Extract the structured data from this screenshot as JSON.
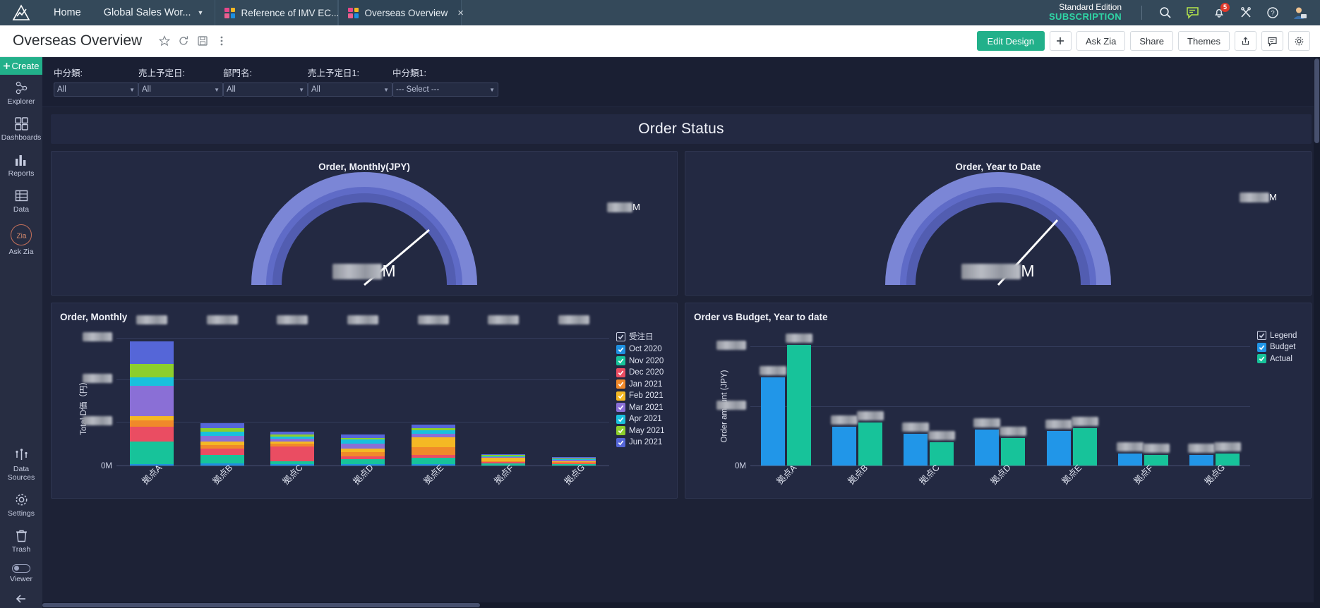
{
  "topbar": {
    "logo_name": "analytics-logo",
    "home_label": "Home",
    "workspace_label": "Global Sales Wor...",
    "tabs": [
      {
        "label": "Reference of IMV EC...",
        "active": false
      },
      {
        "label": "Overseas Overview",
        "active": true
      }
    ],
    "edition_line1": "Standard Edition",
    "edition_line2": "SUBSCRIPTION",
    "notification_count": "5",
    "icons": [
      "search-icon",
      "chat-icon",
      "notification-bell-icon",
      "tools-icon",
      "help-icon",
      "user-avatar-icon"
    ]
  },
  "actionbar": {
    "title": "Overseas Overview",
    "icons": [
      "star-icon",
      "refresh-icon",
      "save-icon",
      "more-options-icon"
    ],
    "edit_design_label": "Edit Design",
    "add_label": "+",
    "ask_zia_label": "Ask Zia",
    "share_label": "Share",
    "themes_label": "Themes",
    "right_icons": [
      "export-icon",
      "comment-icon",
      "settings-gear-icon"
    ]
  },
  "sidebar": {
    "create_label": "Create",
    "items": [
      {
        "label": "Explorer",
        "icon": "explorer-icon"
      },
      {
        "label": "Dashboards",
        "icon": "dashboards-icon"
      },
      {
        "label": "Reports",
        "icon": "reports-icon"
      },
      {
        "label": "Data",
        "icon": "data-icon"
      },
      {
        "label": "Ask Zia",
        "icon": "ask-zia-icon"
      }
    ],
    "bottom_items": [
      {
        "label": "Data Sources",
        "icon": "data-sources-icon"
      },
      {
        "label": "Settings",
        "icon": "settings-icon"
      },
      {
        "label": "Trash",
        "icon": "trash-icon"
      },
      {
        "label": "Viewer",
        "icon": "viewer-toggle-icon"
      }
    ]
  },
  "filters": [
    {
      "label": "中分類:",
      "value": "All"
    },
    {
      "label": "売上予定日:",
      "value": "All"
    },
    {
      "label": "部門名:",
      "value": "All"
    },
    {
      "label": "売上予定日1:",
      "value": "All"
    },
    {
      "label": "中分類1:",
      "value": "--- Select ---"
    }
  ],
  "banner_title": "Order Status",
  "gauges": [
    {
      "title": "Order, Monthly(JPY)",
      "center_value_redacted": true,
      "center_unit": "M",
      "tip_unit": "M",
      "needle_angle_deg": 52
    },
    {
      "title": "Order, Year to Date",
      "center_value_redacted": true,
      "center_unit": "M",
      "tip_unit": "M",
      "needle_angle_deg": 40
    }
  ],
  "chart_data": [
    {
      "type": "bar",
      "title": "Order, Monthly",
      "stacked": true,
      "ylabel": "Total D価（円）",
      "xlabel": "",
      "grid": true,
      "legend_position": "right",
      "legend_header": "受注日",
      "categories": [
        "拠点A",
        "拠点B",
        "拠点C",
        "拠点D",
        "拠点E",
        "拠点F",
        "拠点G"
      ],
      "ytick_labels": [
        "",
        "",
        "",
        "0M"
      ],
      "ytick_redacted": [
        true,
        true,
        true,
        false
      ],
      "series": [
        {
          "name": "Oct 2020",
          "color": "#1e8fe0",
          "values": [
            2,
            3,
            2,
            2,
            2,
            1,
            1
          ]
        },
        {
          "name": "Nov 2020",
          "color": "#17c39a",
          "values": [
            22,
            8,
            3,
            5,
            6,
            2,
            1
          ]
        },
        {
          "name": "Dec 2020",
          "color": "#ea4d62",
          "values": [
            15,
            6,
            14,
            3,
            3,
            1,
            1
          ]
        },
        {
          "name": "Jan 2021",
          "color": "#f0892a",
          "values": [
            6,
            4,
            3,
            4,
            8,
            1,
            1
          ]
        },
        {
          "name": "Feb 2021",
          "color": "#f4b824",
          "values": [
            4,
            3,
            2,
            3,
            9,
            3,
            1
          ]
        },
        {
          "name": "Mar 2021",
          "color": "#8a6fd6",
          "values": [
            30,
            6,
            3,
            5,
            4,
            1,
            1
          ]
        },
        {
          "name": "Apr 2021",
          "color": "#19c0dd",
          "values": [
            8,
            4,
            2,
            4,
            3,
            1,
            1
          ]
        },
        {
          "name": "May 2021",
          "color": "#8dce2c",
          "values": [
            13,
            3,
            2,
            2,
            2,
            1,
            1
          ]
        },
        {
          "name": "Jun 2021",
          "color": "#5566d8",
          "values": [
            22,
            5,
            3,
            3,
            4,
            1,
            1
          ]
        }
      ]
    },
    {
      "type": "bar",
      "title": "Order vs Budget, Year to date",
      "stacked": false,
      "ylabel": "Order amount (JPY)",
      "xlabel": "",
      "grid": true,
      "legend_position": "right",
      "legend_header": "Legend",
      "categories": [
        "拠点A",
        "拠点B",
        "拠点C",
        "拠点D",
        "拠点E",
        "拠点F",
        "拠点G"
      ],
      "ytick_labels": [
        "",
        "",
        "0M"
      ],
      "ytick_redacted": [
        true,
        true,
        false
      ],
      "series": [
        {
          "name": "Budget",
          "color": "#2196e8",
          "values": [
            63,
            28,
            23,
            26,
            25,
            9,
            8
          ]
        },
        {
          "name": "Actual",
          "color": "#17c39a",
          "values": [
            86,
            31,
            17,
            20,
            27,
            8,
            9
          ]
        }
      ]
    }
  ]
}
